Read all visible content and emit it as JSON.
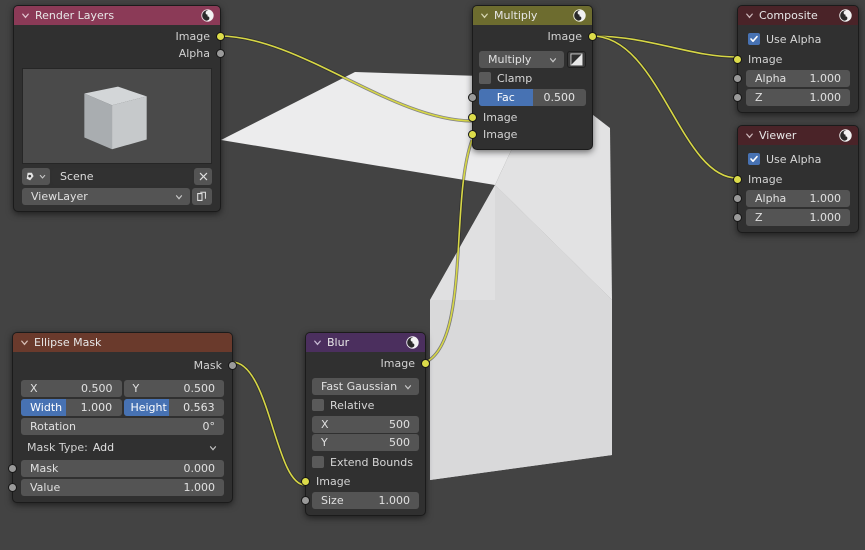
{
  "editor": {
    "name": "Blender Compositor Node Editor",
    "background_color": "#434343",
    "wire_color": "#d7d745"
  },
  "nodes": {
    "render_layers": {
      "title": "Render Layers",
      "header_color": "#8b3a57",
      "outputs": [
        {
          "label": "Image",
          "socket": "image",
          "color": "#dcdc4a"
        },
        {
          "label": "Alpha",
          "socket": "gray",
          "color": "#9a9a9a"
        }
      ],
      "scene_field": {
        "value": "Scene",
        "clear_label": "x"
      },
      "viewlayer_field": {
        "value": "ViewLayer"
      },
      "preview_alt": "rendered cube preview"
    },
    "multiply": {
      "title": "Multiply",
      "header_color": "#6d6c2f",
      "outputs": [
        {
          "label": "Image",
          "socket": "image",
          "color": "#dcdc4a"
        }
      ],
      "blend_mode": "Multiply",
      "clamp": {
        "label": "Clamp",
        "checked": false
      },
      "fac": {
        "label": "Fac",
        "value": "0.500",
        "fill_percent": 50,
        "fill_color": "#4772b3"
      },
      "inputs": [
        {
          "label": "Image",
          "socket": "image",
          "color": "#dcdc4a"
        },
        {
          "label": "Image",
          "socket": "image",
          "color": "#dcdc4a"
        }
      ],
      "fac_socket": {
        "socket": "gray",
        "color": "#9a9a9a"
      }
    },
    "composite": {
      "title": "Composite",
      "header_color": "#4a2328",
      "use_alpha": {
        "label": "Use Alpha",
        "checked": true
      },
      "inputs": [
        {
          "label": "Image",
          "socket": "image",
          "color": "#dcdc4a",
          "type": "plain"
        },
        {
          "label": "Alpha",
          "value": "1.000",
          "socket": "gray",
          "color": "#9a9a9a",
          "type": "field"
        },
        {
          "label": "Z",
          "value": "1.000",
          "socket": "gray",
          "color": "#9a9a9a",
          "type": "field"
        }
      ]
    },
    "viewer": {
      "title": "Viewer",
      "header_color": "#4a2328",
      "use_alpha": {
        "label": "Use Alpha",
        "checked": true
      },
      "inputs": [
        {
          "label": "Image",
          "socket": "image",
          "color": "#dcdc4a",
          "type": "plain"
        },
        {
          "label": "Alpha",
          "value": "1.000",
          "socket": "gray",
          "color": "#9a9a9a",
          "type": "field"
        },
        {
          "label": "Z",
          "value": "1.000",
          "socket": "gray",
          "color": "#9a9a9a",
          "type": "field"
        }
      ]
    },
    "blur": {
      "title": "Blur",
      "header_color": "#4b2f5e",
      "outputs": [
        {
          "label": "Image",
          "socket": "image",
          "color": "#dcdc4a"
        }
      ],
      "filter_type": "Fast Gaussian",
      "relative": {
        "label": "Relative",
        "checked": false
      },
      "size_x": {
        "label": "X",
        "value": "500"
      },
      "size_y": {
        "label": "Y",
        "value": "500"
      },
      "extend_bounds": {
        "label": "Extend Bounds",
        "checked": false
      },
      "inputs": [
        {
          "label": "Image",
          "socket": "image",
          "color": "#dcdc4a",
          "type": "plain"
        },
        {
          "label": "Size",
          "value": "1.000",
          "socket": "gray",
          "color": "#9a9a9a",
          "type": "field"
        }
      ]
    },
    "ellipse_mask": {
      "title": "Ellipse Mask",
      "header_color": "#6a3a2c",
      "outputs": [
        {
          "label": "Mask",
          "socket": "gray",
          "color": "#9a9a9a"
        }
      ],
      "position_x": {
        "label": "X",
        "value": "0.500"
      },
      "position_y": {
        "label": "Y",
        "value": "0.500"
      },
      "width": {
        "label": "Width",
        "value": "1.000",
        "fill_percent": 100,
        "fill_color": "#4772b3"
      },
      "height": {
        "label": "Height",
        "value": "0.563",
        "fill_percent": 56,
        "fill_color": "#4772b3"
      },
      "rotation": {
        "label": "Rotation",
        "value": "0°"
      },
      "mask_type": {
        "label": "Mask Type:",
        "value": "Add"
      },
      "inputs": [
        {
          "label": "Mask",
          "value": "0.000",
          "socket": "gray",
          "color": "#9a9a9a"
        },
        {
          "label": "Value",
          "value": "1.000",
          "socket": "gray",
          "color": "#9a9a9a"
        }
      ]
    }
  }
}
